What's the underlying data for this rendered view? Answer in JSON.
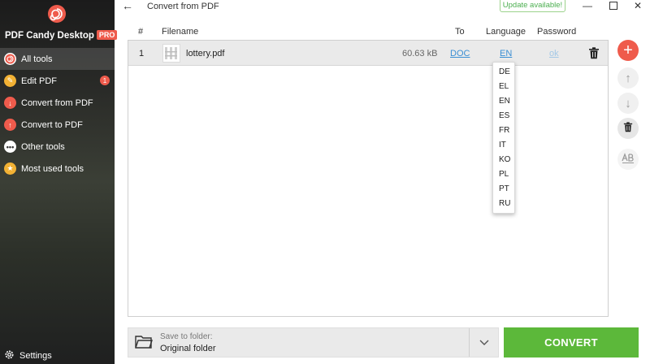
{
  "app": {
    "brand": "PDF Candy Desktop",
    "pro_badge": "PRO"
  },
  "sidebar": {
    "items": [
      {
        "label": "All tools",
        "icon": "spiral-icon",
        "color": "#ef5b4c",
        "active": true
      },
      {
        "label": "Edit PDF",
        "icon": "pencil-icon",
        "color": "#f2b134",
        "badge": "1"
      },
      {
        "label": "Convert from PDF",
        "icon": "arrow-down-icon",
        "color": "#ef5b4c"
      },
      {
        "label": "Convert to PDF",
        "icon": "arrow-up-icon",
        "color": "#ef5b4c"
      },
      {
        "label": "Other tools",
        "icon": "dots-icon",
        "color": "#ffffff"
      },
      {
        "label": "Most used tools",
        "icon": "star-icon",
        "color": "#f2b134"
      }
    ],
    "settings_label": "Settings"
  },
  "header": {
    "title": "Convert from PDF",
    "update_label": "Update available!"
  },
  "table": {
    "columns": {
      "num": "#",
      "filename": "Filename",
      "to": "To",
      "language": "Language",
      "password": "Password"
    },
    "rows": [
      {
        "num": "1",
        "filename": "lottery.pdf",
        "size": "60.63 kB",
        "to": "DOC",
        "language": "EN",
        "password": "ok"
      }
    ]
  },
  "language_dropdown": {
    "options": [
      "DE",
      "EL",
      "EN",
      "ES",
      "FR",
      "IT",
      "KO",
      "PL",
      "PT",
      "RU"
    ]
  },
  "save": {
    "label": "Save to folder:",
    "value": "Original folder"
  },
  "convert_label": "CONVERT",
  "colors": {
    "accent": "#ef5b4c",
    "convert": "#5cb83a",
    "link": "#3b8fd4",
    "update": "#4caf50"
  }
}
